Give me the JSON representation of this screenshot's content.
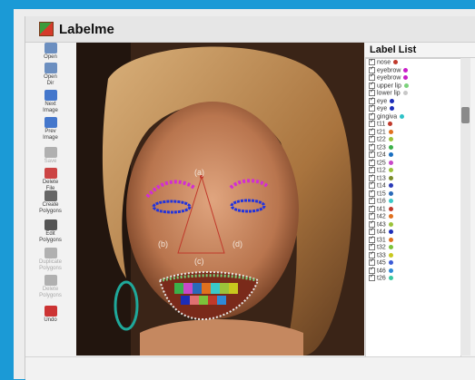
{
  "window": {
    "title": "Labelme"
  },
  "toolbar": [
    {
      "name": "open-button",
      "icon": "folder-open-icon",
      "label": "Open",
      "enabled": true
    },
    {
      "name": "open-dir-button",
      "icon": "folder-open-icon",
      "label": "Open\nDir",
      "enabled": true
    },
    {
      "name": "next-image-button",
      "icon": "arrow-right-icon",
      "label": "Next\nImage",
      "enabled": true
    },
    {
      "name": "prev-image-button",
      "icon": "arrow-left-icon",
      "label": "Prev\nImage",
      "enabled": true
    },
    {
      "name": "save-button",
      "icon": "floppy-icon",
      "label": "Save",
      "enabled": false
    },
    {
      "name": "delete-file-button",
      "icon": "delete-file-icon",
      "label": "Delete\nFile",
      "enabled": true
    },
    {
      "name": "create-polygons-button",
      "icon": "polygon-icon",
      "label": "Create\nPolygons",
      "enabled": true
    },
    {
      "name": "edit-polygons-button",
      "icon": "edit-icon",
      "label": "Edit\nPolygons",
      "enabled": true
    },
    {
      "name": "duplicate-polygons-button",
      "icon": "copy-icon",
      "label": "Duplicate\nPolygons",
      "enabled": false
    },
    {
      "name": "delete-polygons-button",
      "icon": "scissors-icon",
      "label": "Delete\nPolygons",
      "enabled": false
    },
    {
      "name": "undo-button",
      "icon": "undo-icon",
      "label": "Undo",
      "enabled": true
    }
  ],
  "canvas": {
    "annotations": [
      "(a)",
      "(b)",
      "(c)",
      "(d)"
    ]
  },
  "label_list": {
    "title": "Label List",
    "items": [
      {
        "label": "nose",
        "color": "#c0392b"
      },
      {
        "label": "eyebrow",
        "color": "#c81ec8"
      },
      {
        "label": "eyebrow",
        "color": "#c81ec8"
      },
      {
        "label": "upper lip",
        "color": "#7cd27c"
      },
      {
        "label": "lower lip",
        "color": "#c8c8c8"
      },
      {
        "label": "eye",
        "color": "#1c2db8"
      },
      {
        "label": "eye",
        "color": "#1c2db8"
      },
      {
        "label": "gingiva",
        "color": "#2ec2c8"
      },
      {
        "label": "t11",
        "color": "#c0392b"
      },
      {
        "label": "t21",
        "color": "#e0701e"
      },
      {
        "label": "t22",
        "color": "#9bc23a"
      },
      {
        "label": "t23",
        "color": "#3bb04a"
      },
      {
        "label": "t24",
        "color": "#1a6fc0"
      },
      {
        "label": "t25",
        "color": "#c848c8"
      },
      {
        "label": "t12",
        "color": "#9bc23a"
      },
      {
        "label": "t13",
        "color": "#7a8c2a"
      },
      {
        "label": "t14",
        "color": "#2a3ab8"
      },
      {
        "label": "t15",
        "color": "#2a6ab8"
      },
      {
        "label": "t16",
        "color": "#3ac8c8"
      },
      {
        "label": "t41",
        "color": "#c0392b"
      },
      {
        "label": "t42",
        "color": "#e0701e"
      },
      {
        "label": "t43",
        "color": "#9bc23a"
      },
      {
        "label": "t44",
        "color": "#1c2db8"
      },
      {
        "label": "t31",
        "color": "#e0701e"
      },
      {
        "label": "t32",
        "color": "#7cc23a"
      },
      {
        "label": "t33",
        "color": "#c8c81e"
      },
      {
        "label": "t45",
        "color": "#3b5ad6"
      },
      {
        "label": "t46",
        "color": "#2e8ad6"
      },
      {
        "label": "t26",
        "color": "#3ac8a0"
      }
    ]
  },
  "colors": {
    "accent": "#1b9ad6",
    "eyebrow": "#c81ec8",
    "eye": "#1c2db8",
    "nose": "#c0392b",
    "lips": "#e8e8e8"
  }
}
